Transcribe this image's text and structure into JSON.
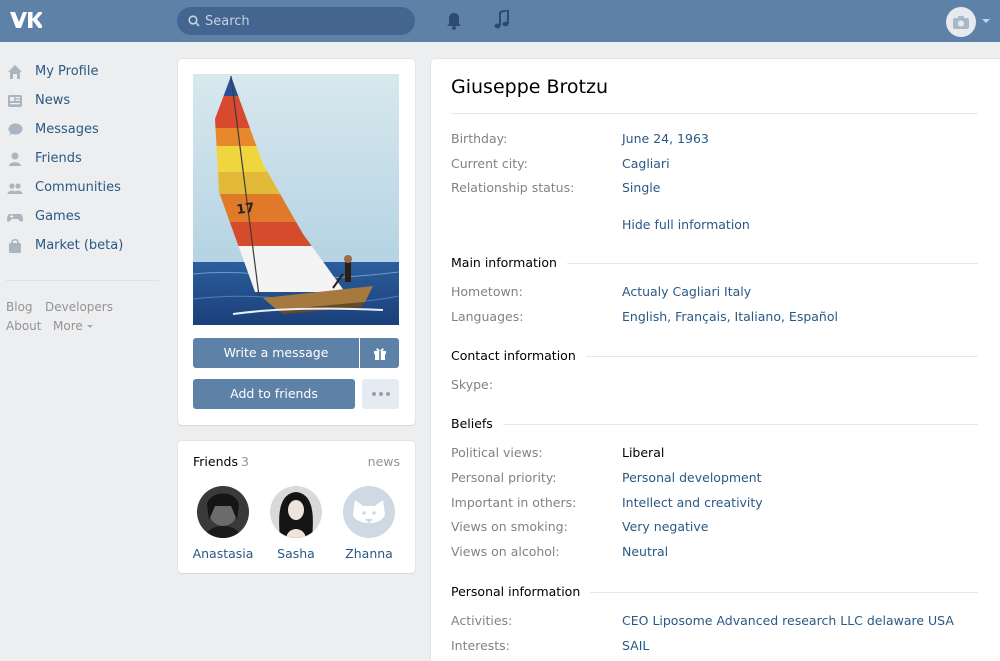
{
  "header": {
    "logo_text": "VK",
    "search_placeholder": "Search"
  },
  "nav": {
    "items": [
      {
        "label": "My Profile",
        "icon": "home-icon"
      },
      {
        "label": "News",
        "icon": "news-icon"
      },
      {
        "label": "Messages",
        "icon": "messages-icon"
      },
      {
        "label": "Friends",
        "icon": "friend-icon"
      },
      {
        "label": "Communities",
        "icon": "communities-icon"
      },
      {
        "label": "Games",
        "icon": "gamepad-icon"
      },
      {
        "label": "Market (beta)",
        "icon": "bag-icon"
      }
    ],
    "footer": {
      "blog": "Blog",
      "developers": "Developers",
      "about": "About",
      "more": "More"
    }
  },
  "profile_actions": {
    "write_message": "Write a message",
    "add_to_friends": "Add to friends"
  },
  "friends": {
    "title": "Friends",
    "count": "3",
    "news_link": "news",
    "list": [
      {
        "name": "Anastasia"
      },
      {
        "name": "Sasha"
      },
      {
        "name": "Zhanna"
      }
    ]
  },
  "info": {
    "name": "Giuseppe Brotzu",
    "basic": [
      {
        "label": "Birthday:",
        "value": "June 24, 1963"
      },
      {
        "label": "Current city:",
        "value": "Cagliari"
      },
      {
        "label": "Relationship status:",
        "value": "Single"
      }
    ],
    "hide_link": "Hide full information",
    "sections": {
      "main": {
        "title": "Main information",
        "rows": [
          {
            "label": "Hometown:",
            "value": "Actualy Cagliari Italy"
          },
          {
            "label": "Languages:",
            "value": "English, Français, Italiano, Español"
          }
        ]
      },
      "contact": {
        "title": "Contact information",
        "rows": [
          {
            "label": "Skype:",
            "value": ""
          }
        ]
      },
      "beliefs": {
        "title": "Beliefs",
        "rows": [
          {
            "label": "Political views:",
            "value": "Liberal"
          },
          {
            "label": "Personal priority:",
            "value": "Personal development"
          },
          {
            "label": "Important in others:",
            "value": "Intellect and creativity"
          },
          {
            "label": "Views on smoking:",
            "value": "Very negative"
          },
          {
            "label": "Views on alcohol:",
            "value": "Neutral"
          }
        ]
      },
      "personal": {
        "title": "Personal information",
        "rows": [
          {
            "label": "Activities:",
            "value": "CEO Liposome Advanced research LLC delaware USA"
          },
          {
            "label": "Interests:",
            "value": "SAIL"
          }
        ]
      }
    }
  },
  "colors": {
    "header": "#5e81a8",
    "link": "#2a5885",
    "label": "#828282",
    "background": "#edeef0"
  }
}
